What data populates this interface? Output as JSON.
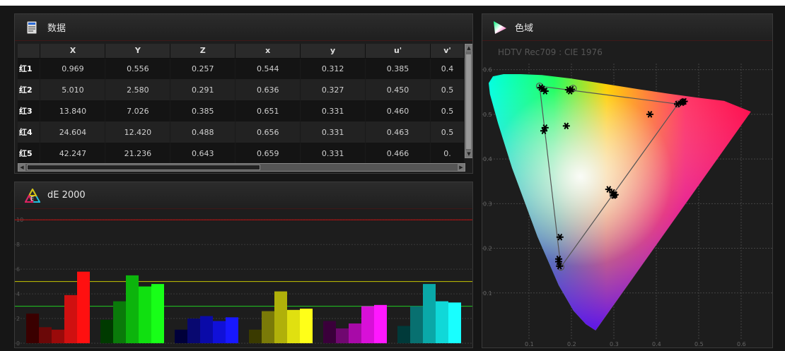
{
  "data_panel": {
    "title": "数据",
    "columns": [
      "",
      "X",
      "Y",
      "Z",
      "x",
      "y",
      "u'",
      "v'"
    ],
    "rows": [
      {
        "label": "红1",
        "cells": [
          "0.969",
          "0.556",
          "0.257",
          "0.544",
          "0.312",
          "0.385",
          "0.4"
        ]
      },
      {
        "label": "红2",
        "cells": [
          "5.010",
          "2.580",
          "0.291",
          "0.636",
          "0.327",
          "0.450",
          "0.5"
        ]
      },
      {
        "label": "红3",
        "cells": [
          "13.840",
          "7.026",
          "0.385",
          "0.651",
          "0.331",
          "0.460",
          "0.5"
        ]
      },
      {
        "label": "红4",
        "cells": [
          "24.604",
          "12.420",
          "0.488",
          "0.656",
          "0.331",
          "0.463",
          "0.5"
        ]
      },
      {
        "label": "红5",
        "cells": [
          "42.247",
          "21.236",
          "0.643",
          "0.659",
          "0.331",
          "0.466",
          "0."
        ]
      }
    ]
  },
  "de_panel": {
    "title": "dE 2000",
    "icon_letter": "E"
  },
  "gamut_panel": {
    "title": "色域",
    "subtitle": "HDTV Rec709 : CIE 1976"
  },
  "chart_data": [
    {
      "type": "bar",
      "title": "dE 2000",
      "ylim": [
        0,
        10.3
      ],
      "yticks": [
        0,
        2,
        4,
        6,
        8,
        10
      ],
      "threshold_lines": [
        {
          "value": 10,
          "color": "#c01010"
        },
        {
          "value": 5,
          "color": "#c8c800"
        },
        {
          "value": 3,
          "color": "#22cc22"
        }
      ],
      "groups": [
        {
          "name": "red",
          "values": [
            2.4,
            1.3,
            1.1,
            3.9,
            5.8
          ],
          "colors": [
            "#3a0000",
            "#6a0808",
            "#9a0a0a",
            "#d01010",
            "#ff1010"
          ]
        },
        {
          "name": "green",
          "values": [
            1.9,
            3.4,
            5.5,
            4.6,
            4.8
          ],
          "colors": [
            "#003a00",
            "#0a7a0a",
            "#0cb40c",
            "#10e010",
            "#18ff18"
          ]
        },
        {
          "name": "blue",
          "values": [
            1.1,
            2.0,
            2.2,
            1.8,
            2.1
          ],
          "colors": [
            "#00003a",
            "#080870",
            "#0a0aa8",
            "#1010d8",
            "#1818ff"
          ]
        },
        {
          "name": "yellow",
          "values": [
            1.1,
            2.6,
            4.2,
            2.7,
            2.8
          ],
          "colors": [
            "#3a3a00",
            "#7a7a08",
            "#b0b00a",
            "#e0e010",
            "#ffff18"
          ]
        },
        {
          "name": "magenta",
          "values": [
            1.8,
            1.2,
            1.6,
            3.0,
            3.1
          ],
          "colors": [
            "#3a003a",
            "#700870",
            "#a80aa8",
            "#d810d8",
            "#ff18ff"
          ]
        },
        {
          "name": "cyan",
          "values": [
            1.4,
            3.0,
            4.8,
            3.4,
            3.3
          ],
          "colors": [
            "#003a3a",
            "#087070",
            "#0aa8a8",
            "#10d8d8",
            "#18ffff"
          ]
        }
      ]
    },
    {
      "type": "scatter",
      "title": "HDTV Rec709 : CIE 1976",
      "xlim": [
        0.0,
        0.65
      ],
      "ylim": [
        0.0,
        0.62
      ],
      "xticks": [
        0.1,
        0.2,
        0.3,
        0.4,
        0.5,
        0.6
      ],
      "yticks": [
        0.1,
        0.2,
        0.3,
        0.4,
        0.5,
        0.6
      ],
      "x_tick_labels": [
        "0.1",
        "0.2",
        "0.3",
        "0.4",
        "0.5",
        "0.6"
      ],
      "y_tick_labels": [
        "0.1",
        "0.2",
        "0.3",
        "0.4",
        "0.5",
        "0.6"
      ],
      "target_triangle": [
        [
          0.451,
          0.523
        ],
        [
          0.125,
          0.563
        ],
        [
          0.175,
          0.158
        ]
      ],
      "target_points": [
        [
          0.451,
          0.523
        ],
        [
          0.125,
          0.563
        ],
        [
          0.175,
          0.158
        ],
        [
          0.298,
          0.319
        ],
        [
          0.204,
          0.558
        ]
      ],
      "measured_points": [
        [
          0.385,
          0.5
        ],
        [
          0.45,
          0.523
        ],
        [
          0.46,
          0.526
        ],
        [
          0.463,
          0.528
        ],
        [
          0.466,
          0.529
        ],
        [
          0.128,
          0.56
        ],
        [
          0.132,
          0.557
        ],
        [
          0.138,
          0.552
        ],
        [
          0.193,
          0.555
        ],
        [
          0.197,
          0.552
        ],
        [
          0.2,
          0.556
        ],
        [
          0.135,
          0.463
        ],
        [
          0.138,
          0.47
        ],
        [
          0.188,
          0.474
        ],
        [
          0.17,
          0.17
        ],
        [
          0.172,
          0.16
        ],
        [
          0.17,
          0.176
        ],
        [
          0.173,
          0.225
        ],
        [
          0.288,
          0.332
        ],
        [
          0.297,
          0.325
        ],
        [
          0.3,
          0.318
        ],
        [
          0.303,
          0.32
        ]
      ]
    }
  ]
}
